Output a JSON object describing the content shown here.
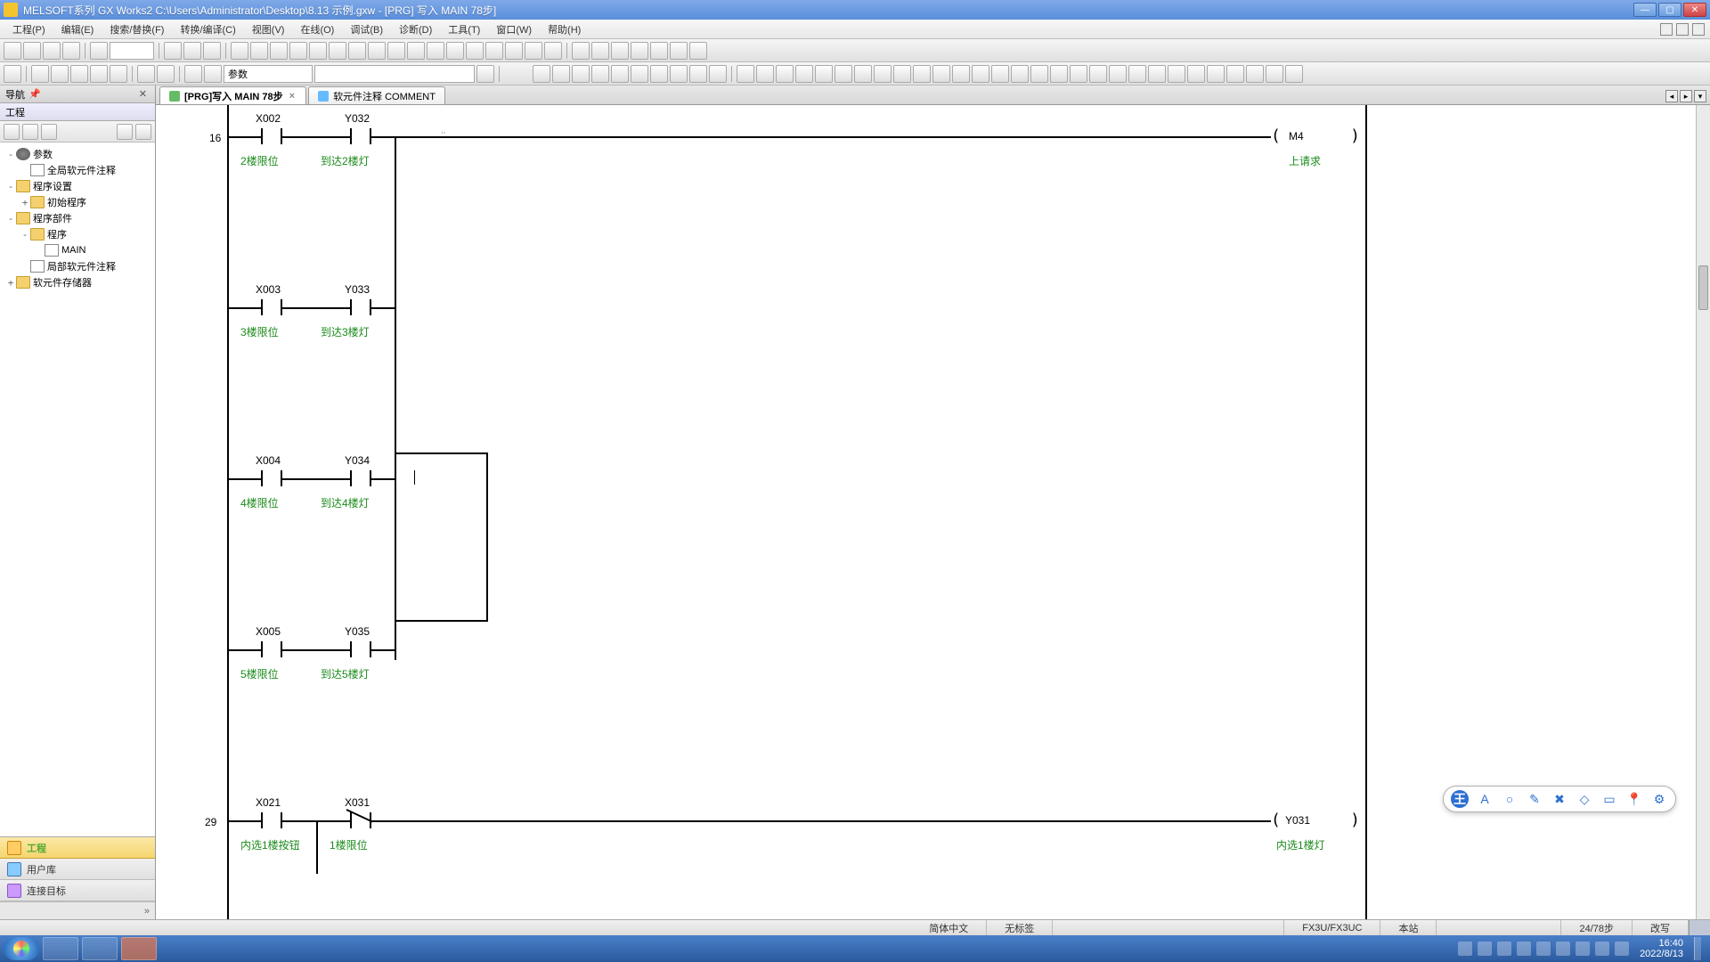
{
  "title": "MELSOFT系列 GX Works2 C:\\Users\\Administrator\\Desktop\\8.13 示例.gxw - [PRG] 写入 MAIN 78步]",
  "menu": [
    "工程(P)",
    "编辑(E)",
    "搜索/替换(F)",
    "转换/编译(C)",
    "视图(V)",
    "在线(O)",
    "调试(B)",
    "诊断(D)",
    "工具(T)",
    "窗口(W)",
    "帮助(H)"
  ],
  "toolbar2_dropdown": "参数",
  "side_header": "导航",
  "side_section": "工程",
  "tree": [
    {
      "indent": 0,
      "exp": "-",
      "icon": "gear",
      "label": "参数"
    },
    {
      "indent": 1,
      "exp": "",
      "icon": "doc",
      "label": "全局软元件注释"
    },
    {
      "indent": 0,
      "exp": "-",
      "icon": "folder",
      "label": "程序设置"
    },
    {
      "indent": 1,
      "exp": "+",
      "icon": "folder",
      "label": "初始程序"
    },
    {
      "indent": 0,
      "exp": "-",
      "icon": "folder",
      "label": "程序部件"
    },
    {
      "indent": 1,
      "exp": "-",
      "icon": "folder",
      "label": "程序"
    },
    {
      "indent": 2,
      "exp": "",
      "icon": "doc",
      "label": "MAIN"
    },
    {
      "indent": 1,
      "exp": "",
      "icon": "doc",
      "label": "局部软元件注释"
    },
    {
      "indent": 0,
      "exp": "+",
      "icon": "folder",
      "label": "软元件存储器"
    }
  ],
  "side_tabs": [
    {
      "label": "工程",
      "active": true
    },
    {
      "label": "用户库",
      "active": false
    },
    {
      "label": "连接目标",
      "active": false
    }
  ],
  "side_foot": "»",
  "tabs": [
    {
      "label": "[PRG]写入 MAIN 78步",
      "active": true
    },
    {
      "label": "软元件注释 COMMENT",
      "active": false
    }
  ],
  "ladder": {
    "step1": "16",
    "step2": "29",
    "r1": {
      "c1": "X002",
      "c2": "Y032",
      "cm1": "2楼限位",
      "cm2": "到达2楼灯",
      "coil": "M4",
      "coilcm": "上请求"
    },
    "r2": {
      "c1": "X003",
      "c2": "Y033",
      "cm1": "3楼限位",
      "cm2": "到达3楼灯"
    },
    "r3": {
      "c1": "X004",
      "c2": "Y034",
      "cm1": "4楼限位",
      "cm2": "到达4楼灯"
    },
    "r4": {
      "c1": "X005",
      "c2": "Y035",
      "cm1": "5楼限位",
      "cm2": "到达5楼灯"
    },
    "r5": {
      "c1": "X021",
      "c2": "X031",
      "cm1": "内选1楼按钮",
      "cm2": "1楼限位",
      "coil": "Y031",
      "coilcm": "内选1楼灯"
    }
  },
  "status": {
    "lang": "简体中文",
    "cap": "无标签",
    "plc": "FX3U/FX3UC",
    "host": "本站",
    "pos": "24/78步",
    "mode": "改写"
  },
  "clock": {
    "time": "16:40",
    "date": "2022/8/13"
  }
}
